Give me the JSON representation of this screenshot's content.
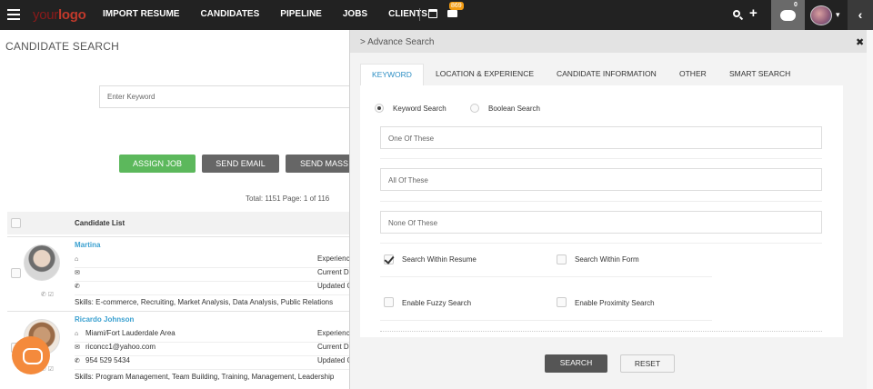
{
  "nav": {
    "logo_your": "your",
    "logo_logo": "logo",
    "menu": [
      "IMPORT RESUME",
      "CANDIDATES",
      "PIPELINE",
      "JOBS",
      "CLIENTS"
    ],
    "mail_badge": "869",
    "chat_count": "0"
  },
  "page": {
    "title": "CANDIDATE SEARCH",
    "keyword_placeholder": "Enter Keyword",
    "buttons": {
      "assign": "ASSIGN JOB",
      "send_email": "SEND EMAIL",
      "send_mass": "SEND MASS E"
    },
    "total": "Total: 1151 Page: 1 of 116",
    "table_header": "Candidate List",
    "candidates": [
      {
        "name": "Martina",
        "location": "",
        "email": "",
        "phone": "",
        "right": [
          "Experienc",
          "Current D",
          "Updated C"
        ],
        "skills": "Skills: E-commerce, Recruiting, Market Analysis, Data Analysis, Public Relations"
      },
      {
        "name": "Ricardo Johnson",
        "location": "Miami/Fort Lauderdale Area",
        "email": "riconcc1@yahoo.com",
        "phone": "954 529 5434",
        "right": [
          "Experienc",
          "Current D",
          "Updated C"
        ],
        "skills": "Skills: Program Management, Team Building, Training, Management, Leadership"
      }
    ]
  },
  "panel": {
    "title": "> Advance Search",
    "tabs": [
      "KEYWORD",
      "LOCATION & EXPERIENCE",
      "CANDIDATE INFORMATION",
      "OTHER",
      "SMART SEARCH"
    ],
    "active_tab": "KEYWORD",
    "radio": {
      "keyword": "Keyword Search",
      "boolean": "Boolean Search",
      "selected": "Keyword Search"
    },
    "fields": {
      "one_of": "One Of These",
      "all_of": "All Of These",
      "none_of": "None Of These"
    },
    "checks": {
      "within_resume": "Search Within Resume",
      "within_form": "Search Within Form",
      "fuzzy": "Enable Fuzzy Search",
      "proximity": "Enable Proximity Search"
    },
    "checked": [
      "Search Within Resume"
    ],
    "search_button": "SEARCH",
    "reset_button": "RESET"
  },
  "colors": {
    "nav_bg": "#222222",
    "assign_green": "#5cb85c",
    "link_blue": "#3aa0d0",
    "active_tab": "#2e8fc4",
    "mail_badge": "#f39c12",
    "chat_bubble": "#f48a3c"
  }
}
